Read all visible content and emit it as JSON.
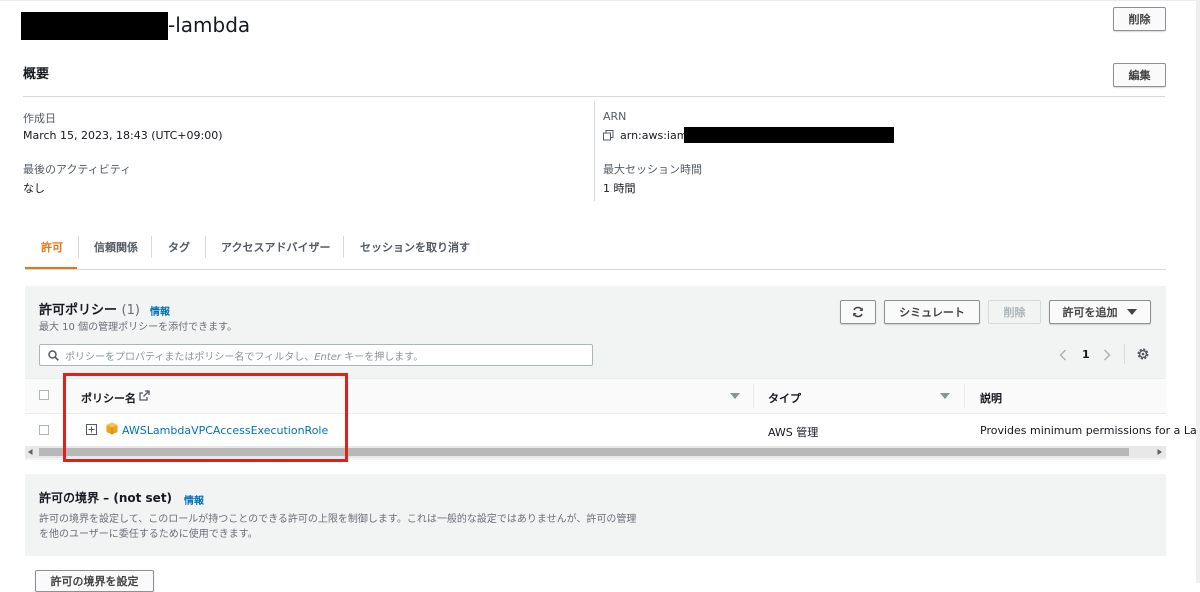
{
  "role": {
    "name_suffix": "-lambda",
    "delete_label": "削除",
    "edit_label": "編集"
  },
  "summary": {
    "title": "概要",
    "created_label": "作成日",
    "created_value": "March 15, 2023, 18:43 (UTC+09:00)",
    "last_activity_label": "最後のアクティビティ",
    "last_activity_value": "なし",
    "arn_label": "ARN",
    "arn_prefix": "arn:aws:iam:",
    "max_session_label": "最大セッション時間",
    "max_session_value": "1 時間"
  },
  "tabs": [
    {
      "label": "許可",
      "active": true
    },
    {
      "label": "信頼関係",
      "active": false
    },
    {
      "label": "タグ",
      "active": false
    },
    {
      "label": "アクセスアドバイザー",
      "active": false
    },
    {
      "label": "セッションを取り消す",
      "active": false
    }
  ],
  "policies": {
    "title": "許可ポリシー",
    "count": "(1)",
    "info": "情報",
    "subtitle": "最大 10 個の管理ポリシーを添付できます。",
    "simulate_label": "シミュレート",
    "delete_label": "削除",
    "add_label": "許可を追加",
    "search_placeholder_before": "ポリシーをプロパティまたはポリシー名でフィルタし、",
    "search_placeholder_key": "Enter",
    "search_placeholder_after": " キーを押します。",
    "page": "1",
    "columns": {
      "name": "ポリシー名",
      "type": "タイプ",
      "description": "説明"
    },
    "rows": [
      {
        "name": "AWSLambdaVPCAccessExecutionRole",
        "type": "AWS 管理",
        "description": "Provides minimum permissions for a La"
      }
    ]
  },
  "boundary": {
    "title": "許可の境界 – (not set)",
    "info": "情報",
    "description_line1": "許可の境界を設定して、このロールが持つことのできる許可の上限を制御します。これは一般的な設定ではありませんが、許可の管理",
    "description_line2": "を他のユーザーに委任するために使用できます。",
    "set_label": "許可の境界を設定"
  },
  "colors": {
    "accent": "#ec7211",
    "link": "#0073bb",
    "highlight": "#e0201a"
  },
  "icons": [
    "refresh-icon",
    "caret-down-icon",
    "search-icon",
    "chevron-left-icon",
    "chevron-right-icon",
    "gear-icon",
    "external-link-icon",
    "copy-icon",
    "expand-icon",
    "policy-cube-icon",
    "sort-caret-icon"
  ]
}
